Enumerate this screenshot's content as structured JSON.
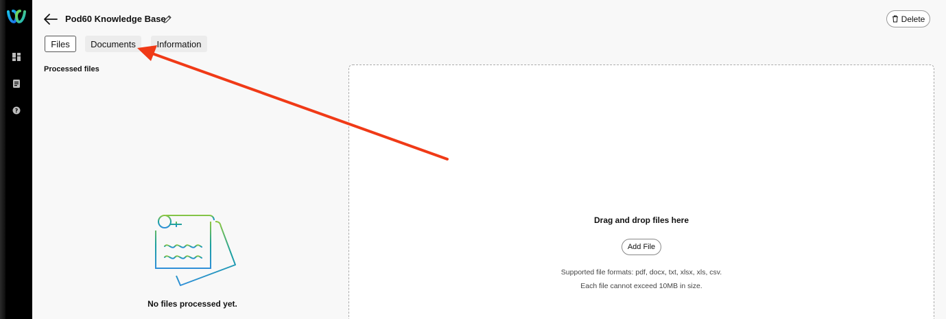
{
  "header": {
    "title": "Pod60 Knowledge Base",
    "delete_label": "Delete"
  },
  "tabs": [
    {
      "label": "Files",
      "selected": true
    },
    {
      "label": "Documents",
      "selected": false
    },
    {
      "label": "Information",
      "selected": false
    }
  ],
  "processed": {
    "heading": "Processed files",
    "empty_text": "No files processed yet."
  },
  "dropzone": {
    "title": "Drag and drop files here",
    "add_file_label": "Add File",
    "formats": "Supported file formats: pdf, docx, txt, xlsx, xls, csv.",
    "size_limit": "Each file cannot exceed 10MB in size."
  },
  "sidebar": {
    "icons": [
      "webex-logo-icon",
      "dashboard-icon",
      "document-icon",
      "help-icon"
    ]
  },
  "colors": {
    "sidebar_bg": "#000000",
    "annotation": "#f03a17",
    "illustration_green": "#8cc63f",
    "illustration_teal": "#1aa0a0",
    "illustration_blue": "#2f8fd8"
  }
}
